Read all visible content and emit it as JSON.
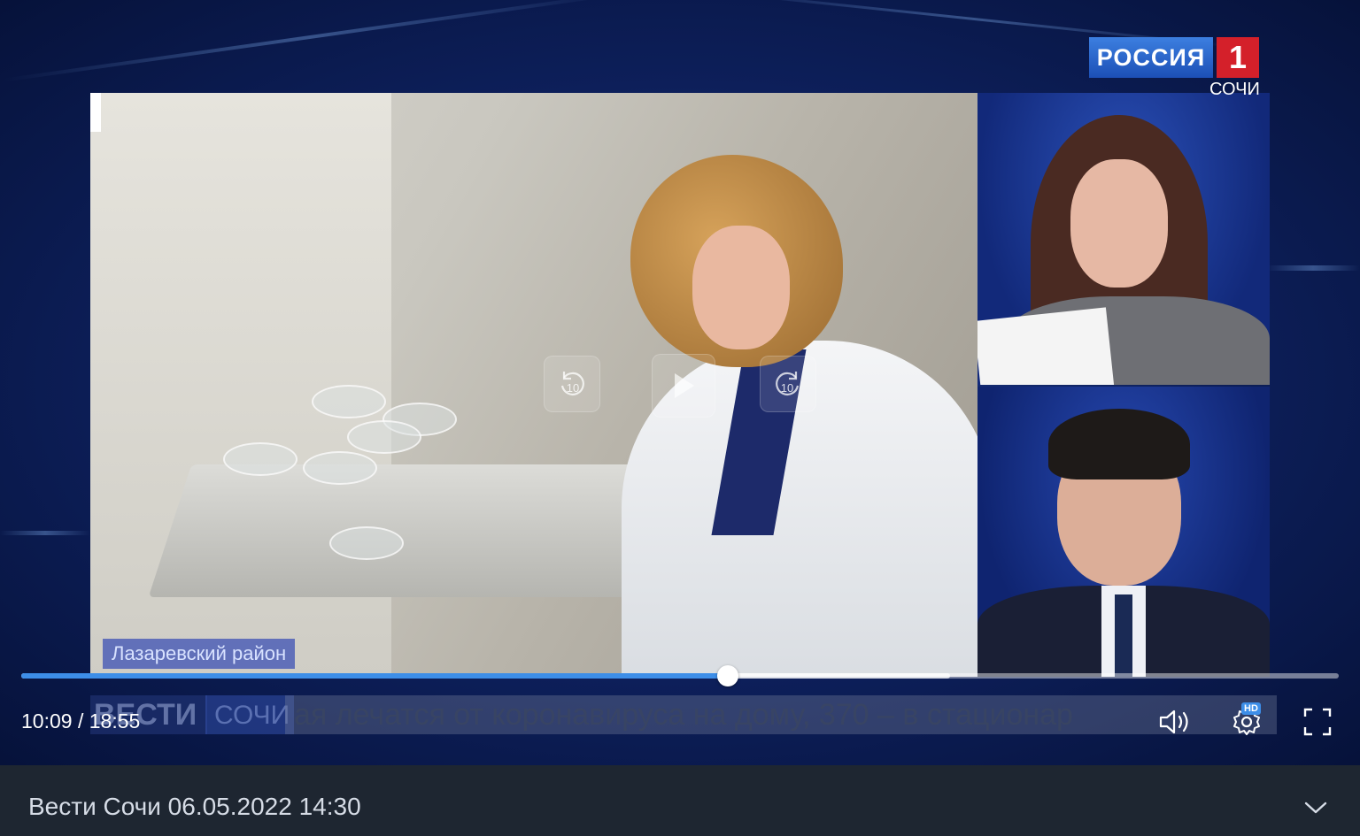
{
  "channel": {
    "logo_name": "РОССИЯ",
    "logo_number": "1",
    "city": "СОЧИ",
    "brand_red": "#d4202a",
    "brand_blue": "#1c4fb6"
  },
  "video": {
    "location_caption": "Лазаревский район",
    "ticker": {
      "brand": "ВЕСТИ",
      "city": "СОЧИ",
      "text": "ая лечатся от коронавируса на дому, 370 – в стационар"
    }
  },
  "overlay_controls": {
    "rewind": {
      "icon": "rewind-10-icon",
      "seconds": "10"
    },
    "play": {
      "icon": "play-icon"
    },
    "forward": {
      "icon": "forward-10-icon",
      "seconds": "10"
    }
  },
  "player": {
    "current_time": "10:09",
    "separator": "/",
    "duration": "18:55",
    "played_fraction": 0.5364,
    "buffered_fraction": 0.705,
    "accent": "#3d8ee8",
    "volume_icon": "speaker-icon",
    "settings_icon": "gear-icon",
    "quality_badge": "HD",
    "fullscreen_icon": "fullscreen-icon"
  },
  "info": {
    "title": "Вести Сочи 06.05.2022 14:30",
    "expand_icon": "chevron-down-icon"
  }
}
